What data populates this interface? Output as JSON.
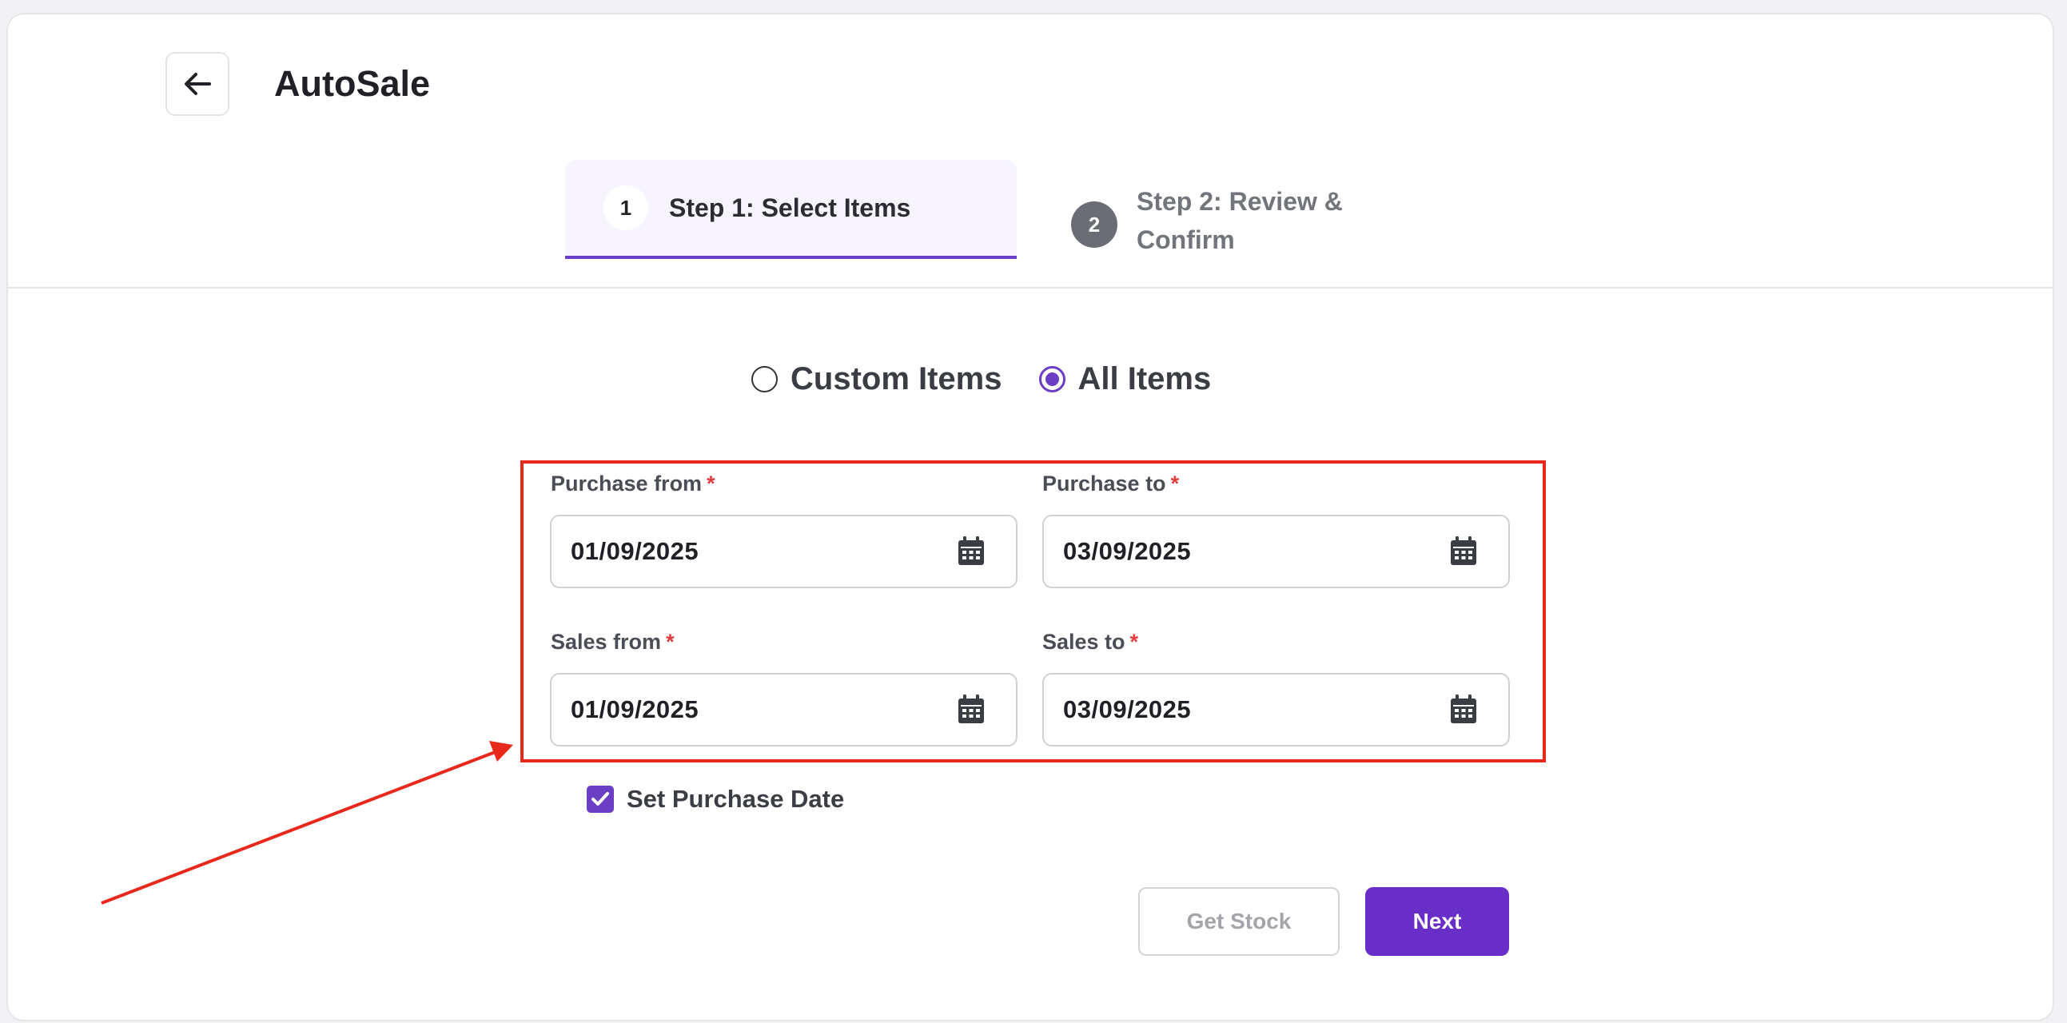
{
  "header": {
    "title": "AutoSale",
    "back_icon": "arrow-left-icon"
  },
  "steps": [
    {
      "number": "1",
      "label": "Step 1: Select Items",
      "active": true
    },
    {
      "number": "2",
      "label": "Step 2: Review & Confirm",
      "active": false
    }
  ],
  "item_mode": {
    "options": [
      {
        "label": "Custom Items",
        "selected": false
      },
      {
        "label": "All Items",
        "selected": true
      }
    ]
  },
  "fields": {
    "purchase_from": {
      "label": "Purchase from",
      "required_mark": "*",
      "value": "01/09/2025"
    },
    "purchase_to": {
      "label": "Purchase to",
      "required_mark": "*",
      "value": "03/09/2025"
    },
    "sales_from": {
      "label": "Sales from",
      "required_mark": "*",
      "value": "01/09/2025"
    },
    "sales_to": {
      "label": "Sales to",
      "required_mark": "*",
      "value": "03/09/2025"
    }
  },
  "set_purchase_date": {
    "label": "Set Purchase Date",
    "checked": true
  },
  "buttons": {
    "get_stock": "Get Stock",
    "next": "Next"
  },
  "colors": {
    "accent": "#6a2ec8",
    "annotation": "#e8281a",
    "required": "#e23b3b"
  }
}
